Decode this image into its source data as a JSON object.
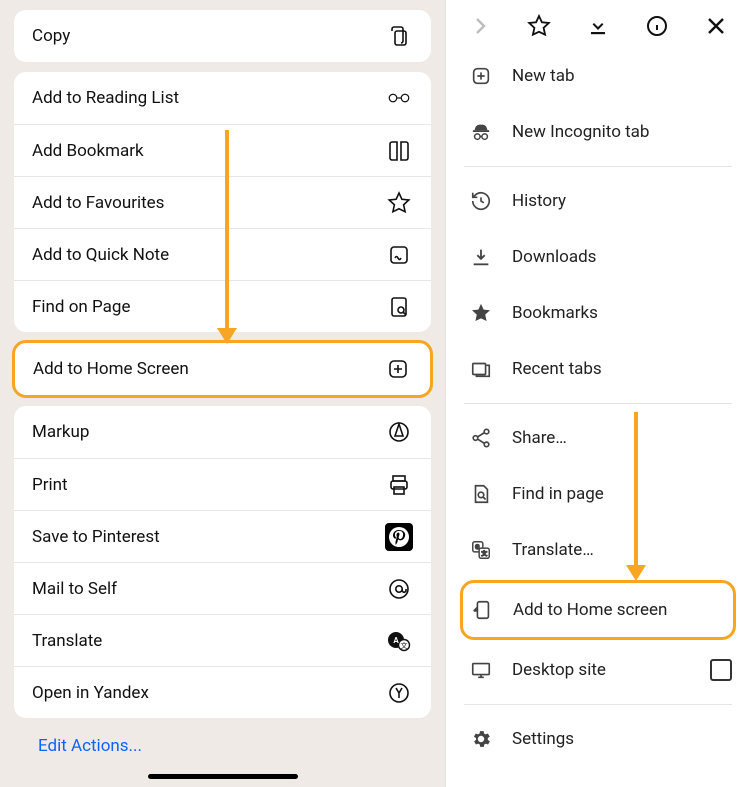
{
  "left": {
    "copy": "Copy",
    "reading_list": "Add to Reading List",
    "add_bookmark": "Add Bookmark",
    "add_favourites": "Add to Favourites",
    "quick_note": "Add to Quick Note",
    "find_on_page": "Find on Page",
    "add_home": "Add to Home Screen",
    "markup": "Markup",
    "print": "Print",
    "pinterest": "Save to Pinterest",
    "mail_self": "Mail to Self",
    "translate": "Translate",
    "yandex": "Open in Yandex",
    "edit_actions": "Edit Actions..."
  },
  "right": {
    "new_tab": "New tab",
    "incognito": "New Incognito tab",
    "history": "History",
    "downloads": "Downloads",
    "bookmarks": "Bookmarks",
    "recent_tabs": "Recent tabs",
    "share": "Share…",
    "find_in_page": "Find in page",
    "translate": "Translate…",
    "add_home": "Add to Home screen",
    "desktop_site": "Desktop site",
    "settings": "Settings"
  }
}
